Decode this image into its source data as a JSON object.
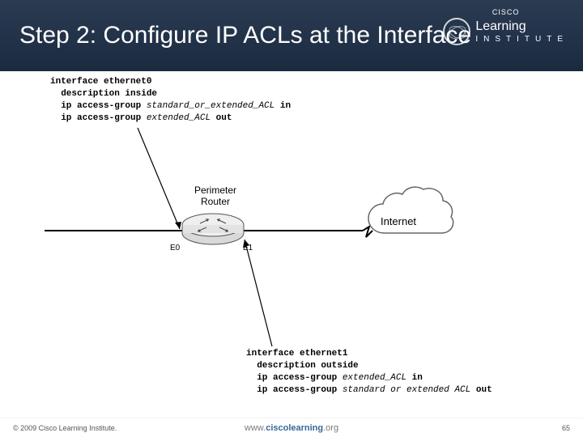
{
  "header": {
    "title": "Step 2: Configure IP ACLs at the Interface",
    "logo_brand": "CISCO",
    "logo_line1": "Learning",
    "logo_line2": "INSTITUTE"
  },
  "config_top": {
    "l1": "interface ethernet0",
    "l2": "  description inside",
    "l3a": "  ip access-group ",
    "l3b": "standard_or_extended_ACL",
    "l3c": " in",
    "l4a": "  ip access-group ",
    "l4b": "extended_ACL",
    "l4c": " out"
  },
  "config_bottom": {
    "l1": "interface ethernet1",
    "l2": "  description outside",
    "l3a": "  ip access-group ",
    "l3b": "extended_ACL",
    "l3c": " in",
    "l4a": "  ip access-group ",
    "l4b": "standard or extended ACL",
    "l4c": " out"
  },
  "diagram": {
    "router_above": "Perimeter",
    "router_label": "Router",
    "port_left": "E0",
    "port_right": "E1",
    "cloud_label": "Internet"
  },
  "footer": {
    "copyright": "© 2009 Cisco Learning Institute.",
    "url_prefix": "www.",
    "url_main": "ciscolearning",
    "url_suffix": ".org",
    "page": "65"
  }
}
